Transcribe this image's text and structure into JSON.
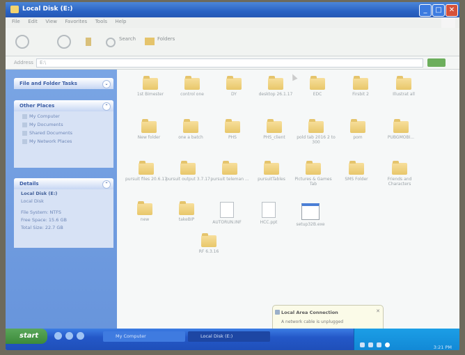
{
  "window": {
    "title": "Local Disk (E:)"
  },
  "menu": [
    "File",
    "Edit",
    "View",
    "Favorites",
    "Tools",
    "Help"
  ],
  "toolbar": {
    "search_label": "Search",
    "folders_label": "Folders"
  },
  "address": {
    "label": "Address",
    "value": "E:\\"
  },
  "task_pane": {
    "file_tasks": {
      "title": "File and Folder Tasks"
    },
    "other_places": {
      "title": "Other Places",
      "items": [
        "My Computer",
        "My Documents",
        "Shared Documents",
        "My Network Places"
      ]
    },
    "details": {
      "title": "Details",
      "name": "Local Disk (E:)",
      "type": "Local Disk",
      "file_system": "File System: NTFS",
      "free_space": "Free Space: 15.6 GB",
      "total_size": "Total Size: 22.7 GB"
    }
  },
  "files": [
    "1st Bimester",
    "control one",
    "DY",
    "desktop 26.1.17",
    "EDC",
    "Firsbit 2",
    "Illustrat all",
    "New folder",
    "one a batch",
    "PHS",
    "PHS_client",
    "pold tab 2016 2 to 300",
    "pom",
    "PUBGMOBI...",
    "pursuit files 20.6.17",
    "pursuit output 3.7.17",
    "pursuit teleman ...",
    "pursuitTables",
    "Pictures & Games Tab",
    "SMS Folder",
    "Friends and Characters",
    "new",
    "takeBIP",
    "AUTORUN.INF",
    "HCC.ppt",
    "setup32B.exe",
    "RF 6.3.16"
  ],
  "balloon": {
    "title": "Local Area Connection",
    "message": "A network cable is unplugged"
  },
  "taskbar": {
    "start_label": "start",
    "tasks": [
      "My Computer",
      "Local Disk (E:)"
    ],
    "clock": "3:21 PM"
  }
}
